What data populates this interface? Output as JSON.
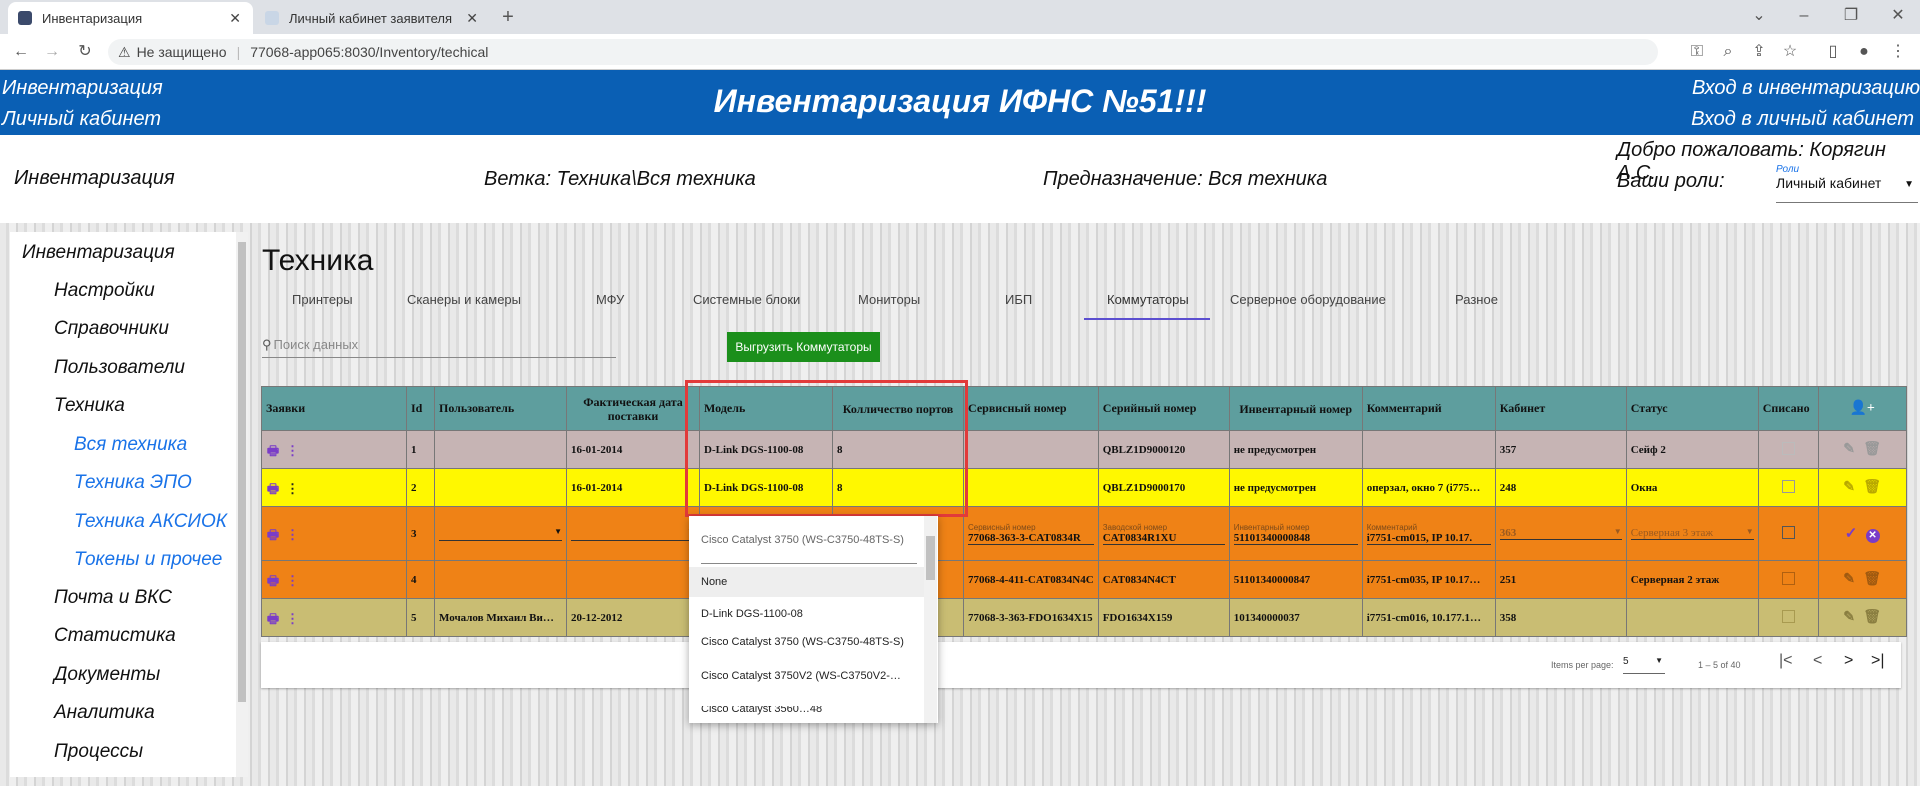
{
  "browser": {
    "tabs": [
      {
        "label": "Инвентаризация",
        "active": true
      },
      {
        "label": "Личный кабинет заявителя",
        "active": false
      }
    ],
    "security": "Не защищено",
    "url": "77068-app065:8030/Inventory/techical"
  },
  "header": {
    "left_links": [
      "Инвентаризация",
      "Личный кабинет"
    ],
    "title": "Инвентаризация ИФНС №51!!!",
    "right_links": [
      "Вход в инвентаризацию",
      "Вход в личный кабинет"
    ]
  },
  "subheader": {
    "section": "Инвентаризация",
    "branch": "Ветка: Техника\\Вся техника",
    "purpose": "Предназначение: Вся техника",
    "welcome": "Добро пожаловать: Корягин А.С.",
    "roles_label": "Ваши роли:",
    "roles_float": "Роли",
    "roles_value": "Личный кабинет"
  },
  "sidebar": {
    "items": [
      {
        "label": "Инвентаризация",
        "level": 0
      },
      {
        "label": "Настройки",
        "level": 1
      },
      {
        "label": "Справочники",
        "level": 1
      },
      {
        "label": "Пользователи",
        "level": 1
      },
      {
        "label": "Техника",
        "level": 1
      },
      {
        "label": "Вся техника",
        "level": 2
      },
      {
        "label": "Техника ЭПО",
        "level": 2
      },
      {
        "label": "Техника АКСИОК",
        "level": 2
      },
      {
        "label": "Токены и прочее",
        "level": 2
      },
      {
        "label": "Почта и ВКС",
        "level": 1
      },
      {
        "label": "Статистика",
        "level": 1
      },
      {
        "label": "Документы",
        "level": 1
      },
      {
        "label": "Аналитика",
        "level": 1
      },
      {
        "label": "Процессы",
        "level": 1
      }
    ]
  },
  "page": {
    "title": "Техника",
    "tabs": [
      "Принтеры",
      "Сканеры и камеры",
      "МФУ",
      "Системные блоки",
      "Мониторы",
      "ИБП",
      "Коммутаторы",
      "Серверное оборудование",
      "Разное"
    ],
    "active_tab": "Коммутаторы",
    "search_placeholder": "Поиск данных",
    "export_label": "Выгрузить Коммутаторы"
  },
  "table": {
    "headers": {
      "requests": "Заявки",
      "id": "Id",
      "user": "Пользователь",
      "delivery_date": "Фактическая дата поставки",
      "model": "Модель",
      "ports": "Колличество портов",
      "service_no": "Сервисный номер",
      "serial_no": "Серийный номер",
      "inventory_no": "Инвентарный номер",
      "comment": "Комментарий",
      "cabinet": "Кабинет",
      "status": "Статус",
      "written_off": "Списано"
    },
    "rows": [
      {
        "id": "1",
        "user": "",
        "date": "16-01-2014",
        "model": "D-Link DGS-1100-08",
        "ports": "8",
        "service": "",
        "serial": "QBLZ1D9000120",
        "inventory": "не предусмотрен",
        "comment": "",
        "cabinet": "357",
        "status": "Сейф 2"
      },
      {
        "id": "2",
        "user": "",
        "date": "16-01-2014",
        "model": "D-Link DGS-1100-08",
        "ports": "8",
        "service": "",
        "serial": "QBLZ1D9000170",
        "inventory": "не предусмотрен",
        "comment": "оперзал, окно 7 (i775…",
        "cabinet": "248",
        "status": "Окна"
      },
      {
        "id": "3",
        "user": "",
        "date": "",
        "model": "",
        "ports": "",
        "service": "77068-363-3-CAT0834R",
        "serial": "CAT0834R1XU",
        "inventory": "51101340000848",
        "comment": "i7751-cm015, IP 10.17.",
        "cabinet": "363",
        "status": "Серверная 3 этаж"
      },
      {
        "id": "4",
        "user": "",
        "date": "",
        "model": "",
        "ports": "",
        "service": "77068-4-411-CAT0834N4C",
        "serial": "CAT0834N4CT",
        "inventory": "51101340000847",
        "comment": "i7751-cm035, IP 10.17…",
        "cabinet": "251",
        "status": "Серверная 2 этаж"
      },
      {
        "id": "5",
        "user": "Мочалов Михаил Ви…",
        "date": "20-12-2012",
        "model": "",
        "ports": "",
        "service": "77068-3-363-FDO1634X15",
        "serial": "FDO1634X159",
        "inventory": "101340000037",
        "comment": "i7751-cm016, 10.177.1…",
        "cabinet": "358",
        "status": ""
      }
    ],
    "edit_labels": {
      "service": "Сервисный номер",
      "serial": "Заводской номер",
      "inventory": "Инвентарный номер",
      "comment": "Комментарий"
    }
  },
  "dropdown": {
    "search_value": "Cisco Catalyst 3750 (WS-C3750-48TS-S)",
    "options": [
      "None",
      "D-Link DGS-1100-08",
      "Cisco Catalyst 3750 (WS-C3750-48TS-S)",
      "Cisco Catalyst 3750V2 (WS-C3750V2-…",
      "Cisco Catalyst 3560…48"
    ]
  },
  "paginator": {
    "items_per_page_label": "Items per page:",
    "items_per_page": "5",
    "range": "1 – 5 of 40"
  },
  "colors": {
    "banner": "#0a5fb4",
    "header_row": "#5e9e9e",
    "row1": "#c6b4b4",
    "row2": "#fff800",
    "row3": "#ef8216",
    "row5": "#c9bd73",
    "export_button": "#1b8f1b",
    "highlight": "#e23a3a"
  }
}
